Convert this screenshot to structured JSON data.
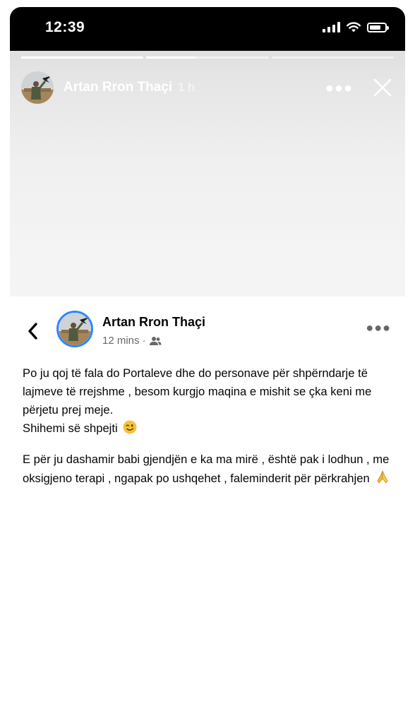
{
  "status_bar": {
    "time": "12:39",
    "icons": [
      "signal-icon",
      "wifi-icon",
      "battery-icon"
    ]
  },
  "story": {
    "progress": [
      1.0,
      0.4,
      0
    ],
    "author_name": "Artan Rron Thaçi",
    "time_ago": "1 h",
    "more_icon": "more-horizontal-icon",
    "close_icon": "close-icon"
  },
  "post": {
    "back_icon": "chevron-left-icon",
    "author_name": "Artan Rron Thaçi",
    "time_ago": "12 mins",
    "separator": "·",
    "audience_icon": "friends-icon",
    "more_icon": "more-horizontal-icon",
    "paragraph1": "Po ju qoj të fala do Portaleve dhe do personave për shpërndarje të lajmeve të rrejshme , besom kurgjo maqina e mishit se çka keni me përjetu prej meje.",
    "line2": "Shihemi së shpejti",
    "paragraph2": "E për ju dashamir babi gjendjën e ka ma mirë , është pak i lodhun , me oksigjeno terapi , ngapak po ushqehet , faleminderit për përkrahjen",
    "wink_emoji": "wink-emoji-icon",
    "pray_emoji": "folded-hands-emoji-icon"
  },
  "colors": {
    "accent_ring": "#2d88ff",
    "meta_gray": "#65676b",
    "text_dark": "#050505"
  }
}
